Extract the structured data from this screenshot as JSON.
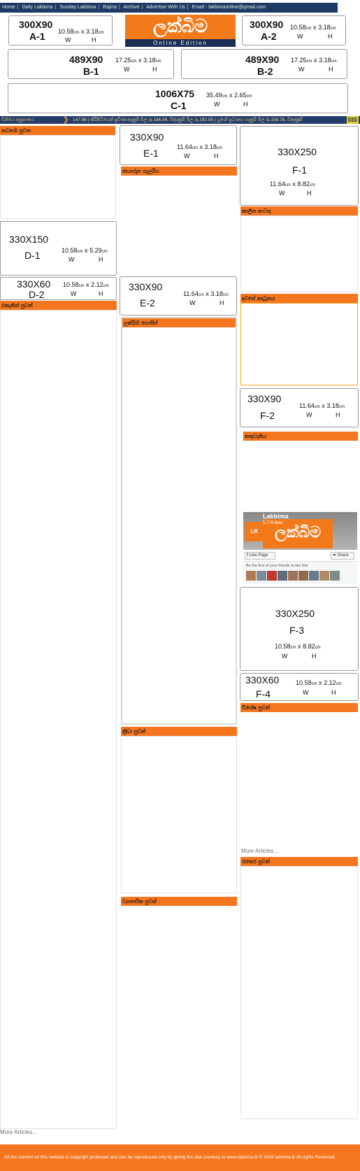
{
  "nav": {
    "items": [
      "Home",
      "Daily Lakbima",
      "Sunday Lakbima",
      "Rajina",
      "Archive",
      "Advertise With Us",
      "Email - lakbimaonline@gmail.com"
    ]
  },
  "logo": {
    "sinhala": "ලක්බිම",
    "edition": "Online Edition"
  },
  "ads": {
    "a1": {
      "size": "300X90",
      "code": "A-1",
      "w": "10.58",
      "h": "3.18"
    },
    "a2": {
      "size": "300X90",
      "code": "A-2",
      "w": "10.58",
      "h": "3.18"
    },
    "b1": {
      "size": "489X90",
      "code": "B-1",
      "w": "17.25",
      "h": "3.18"
    },
    "b2": {
      "size": "489X90",
      "code": "B-2",
      "w": "17.25",
      "h": "3.18"
    },
    "c1": {
      "size": "1006X75",
      "code": "C-1",
      "w": "35.49",
      "h": "2.65"
    },
    "d1": {
      "size": "330X150",
      "code": "D-1",
      "w": "10.58",
      "h": "5.29"
    },
    "d2": {
      "size": "330X60",
      "code": "D-2",
      "w": "10.58",
      "h": "2.12"
    },
    "e1": {
      "size": "330X90",
      "code": "E-1",
      "w": "11.64",
      "h": "3.18"
    },
    "e2": {
      "size": "330X90",
      "code": "E-2",
      "w": "11.64",
      "h": "3.18"
    },
    "f1": {
      "size": "330X250",
      "code": "F-1",
      "w": "11.64",
      "h": "8.82"
    },
    "f2": {
      "size": "330X90",
      "code": "F-2",
      "w": "11.64",
      "h": "3.18"
    },
    "f3": {
      "size": "330X250",
      "code": "F-3",
      "w": "10.58",
      "h": "8.82"
    },
    "f4": {
      "size": "330X60",
      "code": "F-4",
      "w": "10.58",
      "h": "2.12"
    },
    "unit": "cm",
    "times": "x",
    "w_label": "W",
    "h_label": "H"
  },
  "ticker": {
    "label": "විනිමය අනුපාතය",
    "text": "147.96 | කිරිපිටියෙන් ප්‍රවීණ කැනුම් මිල රු.186.06, විකුණුම් මිල රු.192.55 | යුරෝ ප්‍රධානය ගැනුම් මිල රු.158.78, විකුණුම්",
    "badge": "$$$"
  },
  "sections": {
    "latest": "නවතම පුවත",
    "photo_gallery": "ඡායාරූප ගැලරිය",
    "cartoon": "කාලීන සංවාද",
    "exclusive": "එකැකින් පුවත්",
    "gossip": "ලක්බිම ගොසිප්",
    "daily_cartoon": "දවසේ කාටූනය",
    "puzzle": "කතුවැකිය",
    "sports": "ක්‍රීඩා පුවත්",
    "special": "විශේෂ පුවත්",
    "foreign": "එතෙර පුවත්",
    "business": "ව්‍යාපාරික පුවත්"
  },
  "more_articles": "More Articles...",
  "facebook": {
    "page_name": "Lakbima",
    "likes": "5,778 likes",
    "like_label": "Like Page",
    "share_label": "Share",
    "friends_text": "Be the first of your friends to like this"
  },
  "footer": {
    "text": "All the content on this website is copyright protected and can be reproduced only by giving the due courtesy to www.lakbima.lk © 2016 lakbima.lk All rights Reserved."
  },
  "colors": {
    "orange": "#f5761f",
    "navy": "#1e3a62",
    "border": "#9a9a9a"
  }
}
